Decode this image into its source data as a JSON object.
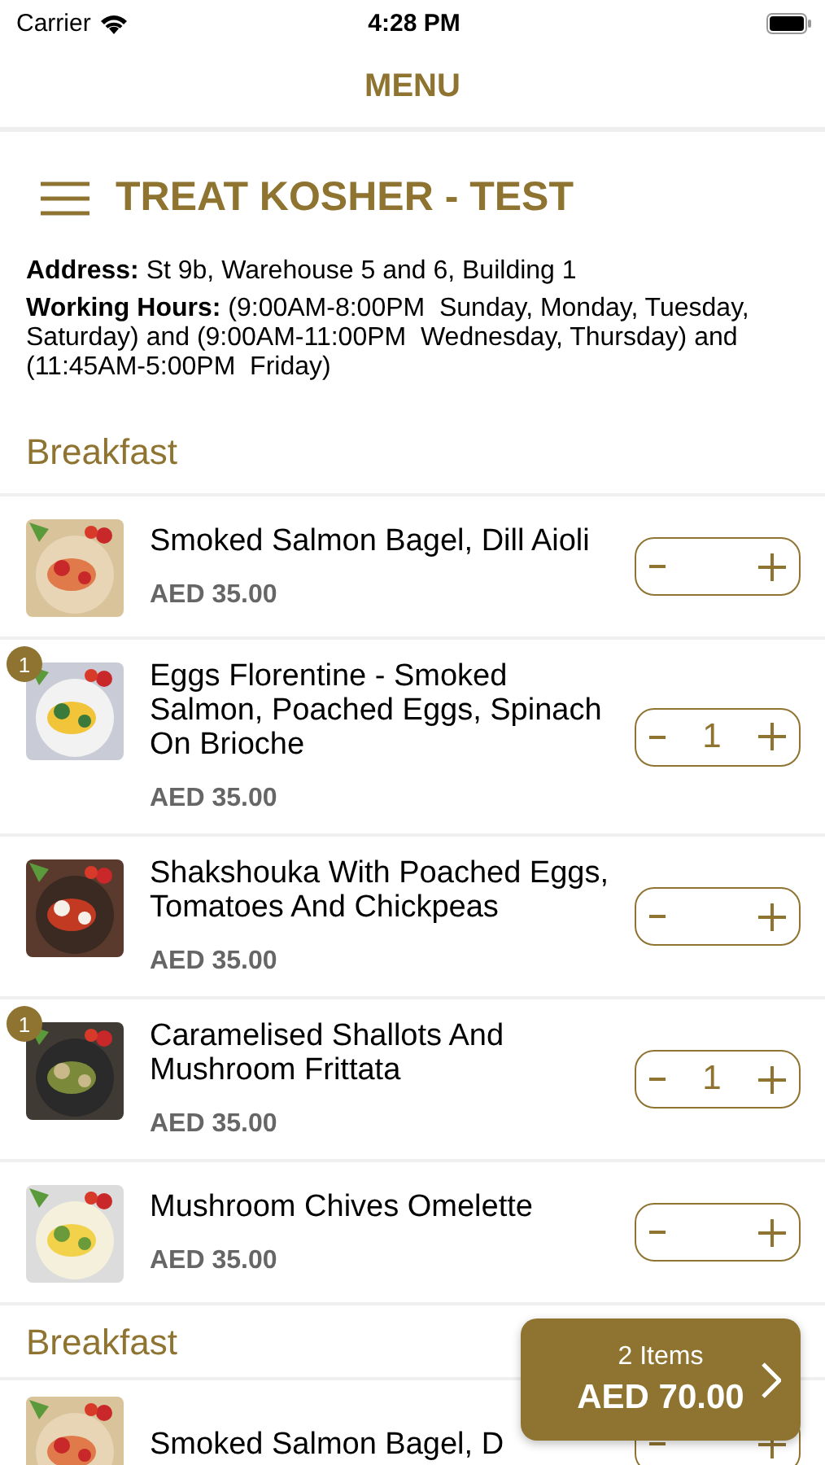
{
  "status_bar": {
    "carrier": "Carrier",
    "time": "4:28 PM"
  },
  "nav": {
    "title": "MENU"
  },
  "restaurant": {
    "name": "TREAT KOSHER - TEST",
    "address_label": "Address:",
    "address": "St 9b, Warehouse 5 and 6, Building 1",
    "hours_label": "Working Hours:",
    "hours": "(9:00AM-8:00PM  Sunday, Monday, Tuesday, Saturday) and (9:00AM-11:00PM  Wednesday, Thursday) and (11:45AM-5:00PM  Friday)"
  },
  "sections": [
    {
      "title": "Breakfast",
      "items": [
        {
          "name": "Smoked Salmon Bagel, Dill Aioli",
          "price": "AED 35.00"
        },
        {
          "name": "Eggs Florentine - Smoked Salmon, Poached Eggs, Spinach On Brioche",
          "price": "AED 35.00",
          "badge": "1",
          "quantity": "1"
        },
        {
          "name": "Shakshouka With Poached Eggs, Tomatoes And Chickpeas",
          "price": "AED 35.00"
        },
        {
          "name": "Caramelised Shallots And Mushroom Frittata",
          "price": "AED 35.00",
          "badge": "1",
          "quantity": "1"
        },
        {
          "name": "Mushroom Chives Omelette",
          "price": "AED 35.00"
        }
      ]
    },
    {
      "title": "Breakfast",
      "items": [
        {
          "name": "Smoked Salmon Bagel, D"
        }
      ]
    }
  ],
  "cart": {
    "count": "2 Items",
    "total": "AED 70.00"
  }
}
